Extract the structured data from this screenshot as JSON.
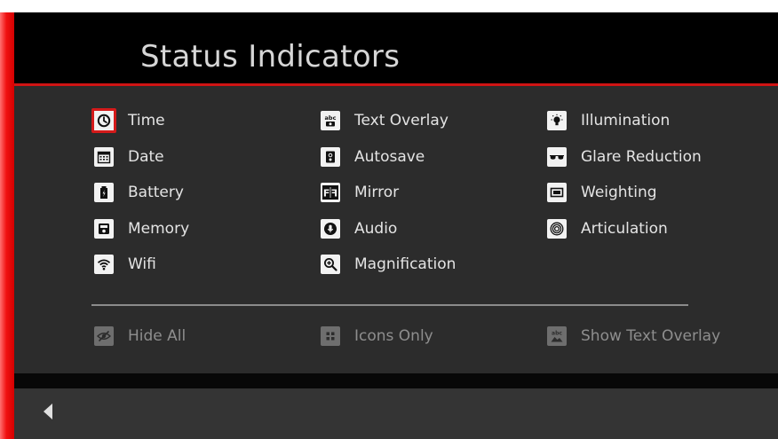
{
  "header": {
    "title": "Status Indicators"
  },
  "indicators": {
    "col1": [
      {
        "label": "Time",
        "icon": "clock-icon",
        "selected": true
      },
      {
        "label": "Date",
        "icon": "calendar-icon"
      },
      {
        "label": "Battery",
        "icon": "battery-icon"
      },
      {
        "label": "Memory",
        "icon": "memory-card-icon"
      },
      {
        "label": "Wifi",
        "icon": "wifi-icon"
      }
    ],
    "col2": [
      {
        "label": "Text Overlay",
        "icon": "text-overlay-icon"
      },
      {
        "label": "Autosave",
        "icon": "autosave-icon"
      },
      {
        "label": "Mirror",
        "icon": "mirror-icon"
      },
      {
        "label": "Audio",
        "icon": "microphone-icon"
      },
      {
        "label": "Magnification",
        "icon": "magnify-icon"
      }
    ],
    "col3": [
      {
        "label": "Illumination",
        "icon": "lightbulb-icon"
      },
      {
        "label": "Glare Reduction",
        "icon": "sunglasses-icon"
      },
      {
        "label": "Weighting",
        "icon": "weighting-icon"
      },
      {
        "label": "Articulation",
        "icon": "articulation-icon"
      }
    ]
  },
  "options": {
    "hide_all": "Hide All",
    "icons_only": "Icons Only",
    "show_text_overlay": "Show Text Overlay"
  },
  "footer": {
    "back_icon": "back-arrow-icon"
  },
  "colors": {
    "accent": "#cf1414",
    "background": "#2c2c2c",
    "header": "#000000",
    "text": "#e4e4e4",
    "disabled_text": "#8e8e8e"
  }
}
